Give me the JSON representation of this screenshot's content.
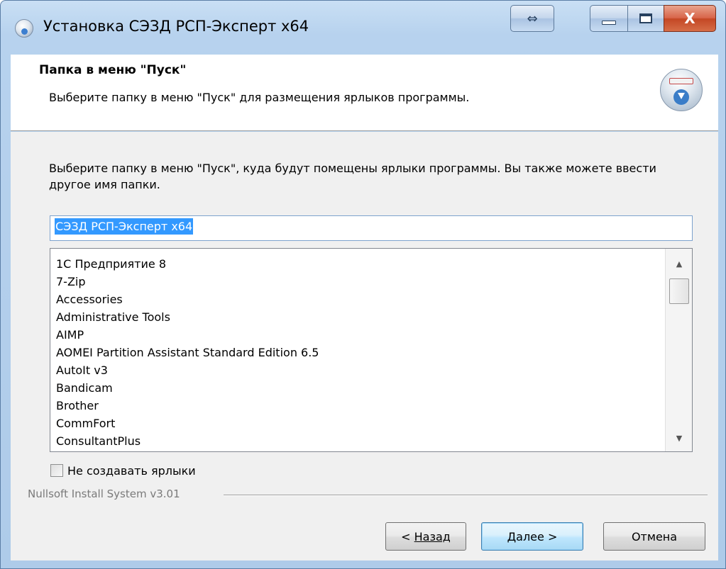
{
  "window": {
    "title": "Установка СЭЗД РСП-Эксперт x64",
    "resize_glyph": "⇔",
    "close_glyph": "X"
  },
  "header": {
    "title": "Папка в меню \"Пуск\"",
    "subtitle": "Выберите папку в меню \"Пуск\" для размещения ярлыков программы.",
    "icon": "installer-icon"
  },
  "body": {
    "instructions": "Выберите папку в меню \"Пуск\", куда будут помещены ярлыки программы. Вы также можете ввести другое имя папки.",
    "folder_value": "СЭЗД РСП-Эксперт x64",
    "folders": [
      "1C Предприятие 8",
      "7-Zip",
      "Accessories",
      "Administrative Tools",
      "AIMP",
      "AOMEI Partition Assistant Standard Edition 6.5",
      "AutoIt v3",
      "Bandicam",
      "Brother",
      "CommFort",
      "ConsultantPlus"
    ],
    "checkbox_label": "Не создавать ярлыки",
    "checkbox_checked": false,
    "branding": "Nullsoft Install System v3.01"
  },
  "buttons": {
    "back_prefix": "< ",
    "back_label": "Назад",
    "next_label": "Далее >",
    "cancel_label": "Отмена"
  },
  "scrollbar": {
    "up_glyph": "▲",
    "down_glyph": "▼"
  }
}
